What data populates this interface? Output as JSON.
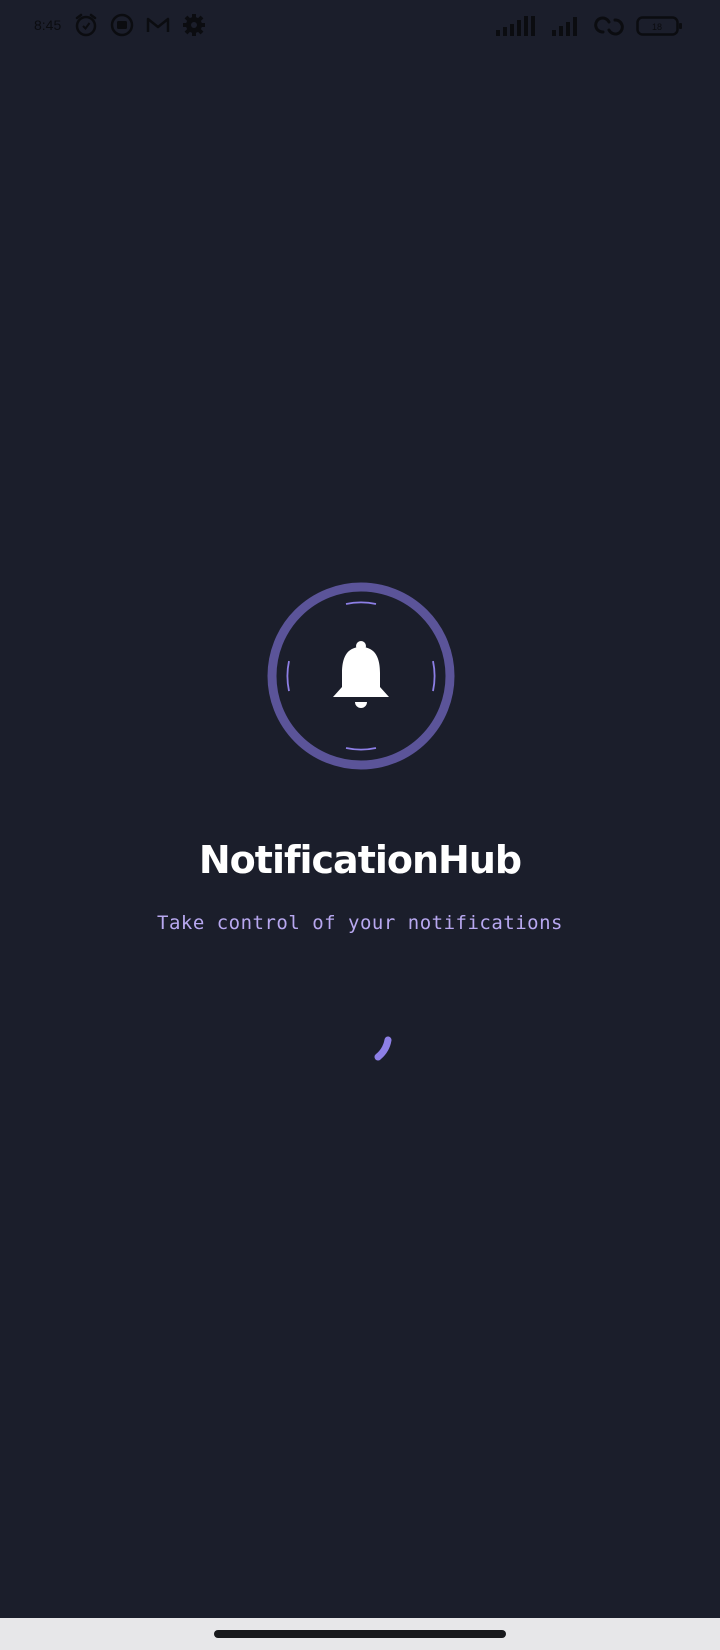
{
  "status_bar": {
    "time": "8:45",
    "left_icons": [
      "alarm-icon",
      "screen-record-icon",
      "gmail-icon",
      "settings-icon"
    ],
    "right_icons": [
      "signal-4g-icon",
      "signal-icon",
      "hotspot-icon",
      "battery-icon"
    ],
    "battery_level": "18"
  },
  "splash": {
    "logo_icon": "bell-icon",
    "title": "NotificationHub",
    "tagline": "Take control of your notifications",
    "loading_icon": "loading-spinner-icon"
  },
  "colors": {
    "background": "#1b1e2b",
    "ring": "#5b5499",
    "accent": "#8d7fe6",
    "tagline": "#b8a8f0",
    "title": "#ffffff",
    "nav_bar": "#e7e7e9"
  }
}
